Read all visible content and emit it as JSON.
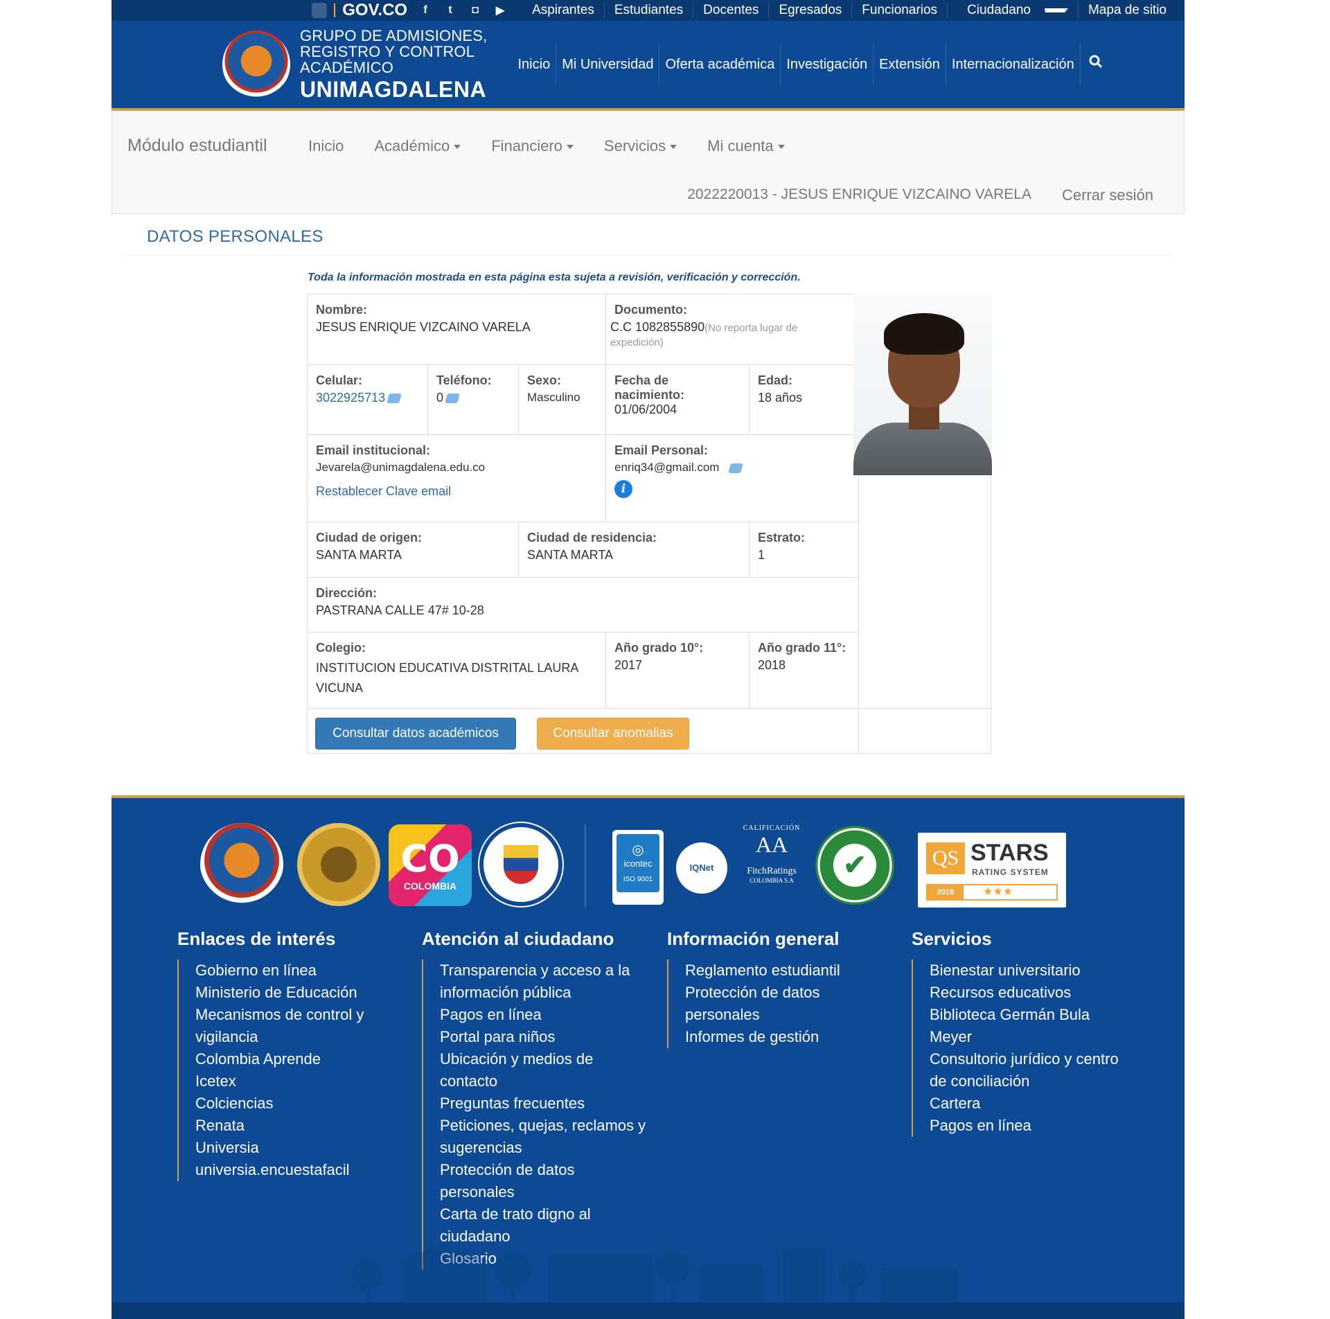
{
  "govbar": {
    "gov_label": "GOV.CO",
    "social": [
      "facebook-icon",
      "twitter-icon",
      "instagram-icon",
      "youtube-icon"
    ],
    "social_glyphs": [
      "f",
      "t",
      "◘",
      "▶"
    ],
    "links": [
      "Aspirantes",
      "Estudiantes",
      "Docentes",
      "Egresados",
      "Funcionarios",
      "Ciudadano",
      "Mapa de sitio"
    ]
  },
  "header": {
    "title_small": [
      "GRUPO DE ADMISIONES,",
      "REGISTRO Y CONTROL",
      "ACADÉMICO"
    ],
    "title_big": "UNIMAGDALENA",
    "nav": [
      "Inicio",
      "Mi Universidad",
      "Oferta académica",
      "Investigación",
      "Extensión",
      "Internacionalización"
    ]
  },
  "modnav": {
    "brand": "Módulo estudiantil",
    "items": [
      "Inicio",
      "Académico",
      "Financiero",
      "Servicios",
      "Mi cuenta"
    ],
    "user": "2022220013 - JESUS ENRIQUE VIZCAINO VARELA",
    "logout": "Cerrar sesión"
  },
  "page": {
    "section_title": "DATOS PERSONALES",
    "notice": "Toda la información mostrada en esta página esta sujeta a revisión, verificación y corrección."
  },
  "person": {
    "nombre_label": "Nombre:",
    "nombre": "JESUS ENRIQUE VIZCAINO VARELA",
    "documento_label": "Documento:",
    "documento": "C.C 1082855890",
    "documento_note": "(No reporta lugar de expedición)",
    "celular_label": "Celular:",
    "celular": "3022925713",
    "telefono_label": "Teléfono:",
    "telefono": "0",
    "sexo_label": "Sexo:",
    "sexo": "Masculino",
    "nacimiento_label": "Fecha de nacimiento:",
    "nacimiento": "01/06/2004",
    "edad_label": "Edad:",
    "edad": "18 años",
    "email_inst_label": "Email institucional:",
    "email_inst": "Jevarela@unimagdalena.edu.co",
    "reset_link": "Restablecer Clave email",
    "email_pers_label": "Email Personal:",
    "email_pers": "enriq34@gmail.com",
    "ciudad_origen_label": "Ciudad de origen:",
    "ciudad_origen": "SANTA MARTA",
    "ciudad_res_label": "Ciudad de residencia:",
    "ciudad_res": "SANTA MARTA",
    "estrato_label": "Estrato:",
    "estrato": "1",
    "direccion_label": "Dirección:",
    "direccion": "PASTRANA CALLE 47# 10-28",
    "colegio_label": "Colegio:",
    "colegio": "INSTITUCION EDUCATIVA DISTRITAL LAURA VICUNA",
    "grado10_label": "Año grado 10°:",
    "grado10": "2017",
    "grado11_label": "Año grado 11°:",
    "grado11": "2018"
  },
  "buttons": {
    "academicos": "Consultar datos académicos",
    "anomalias": "Consultar anomalias"
  },
  "footer": {
    "logos": {
      "co": "CO",
      "colombia": "COLOMBIA",
      "icontec": "icontec",
      "iso": "ISO 9001",
      "iqnet": "IQNet",
      "calificacion": "CALIFICACIÓN",
      "aa": "AA",
      "fitch": "FitchRatings",
      "fitch_country": "COLOMBIA S.A",
      "qs": "QS",
      "stars": "STARS",
      "rating": "RATING SYSTEM",
      "year": "2018",
      "star_glyphs": "★★★"
    },
    "columns": [
      {
        "title": "Enlaces de interés",
        "items": [
          "Gobierno en línea",
          "Ministerio de Educación",
          "Mecanismos de control y vigilancia",
          "Colombia Aprende",
          "Icetex",
          "Colciencias",
          "Renata",
          "Universia",
          "universia.encuestafacil"
        ]
      },
      {
        "title": "Atención al ciudadano",
        "items": [
          "Transparencia y acceso a la información pública",
          "Pagos en línea",
          "Portal para niños",
          "Ubicación y medios de contacto",
          "Preguntas frecuentes",
          "Peticiones, quejas, reclamos y sugerencias",
          "Protección de datos personales",
          "Carta de trato digno al ciudadano",
          "Glosario"
        ]
      },
      {
        "title": "Información general",
        "items": [
          "Reglamento estudiantil",
          "Protección de datos personales",
          "Informes de gestión"
        ]
      },
      {
        "title": "Servicios",
        "items": [
          "Bienestar universitario",
          "Recursos educativos",
          "Biblioteca Germán Bula Meyer",
          "Consultorio jurídico y centro de conciliación",
          "Cartera",
          "Pagos en línea"
        ]
      }
    ]
  },
  "colors": {
    "brand_blue": "#0d4a93",
    "gold": "#c9a24a",
    "link": "#2f6aa3",
    "btn_blue": "#337ab7",
    "btn_orange": "#f0ad4e"
  }
}
